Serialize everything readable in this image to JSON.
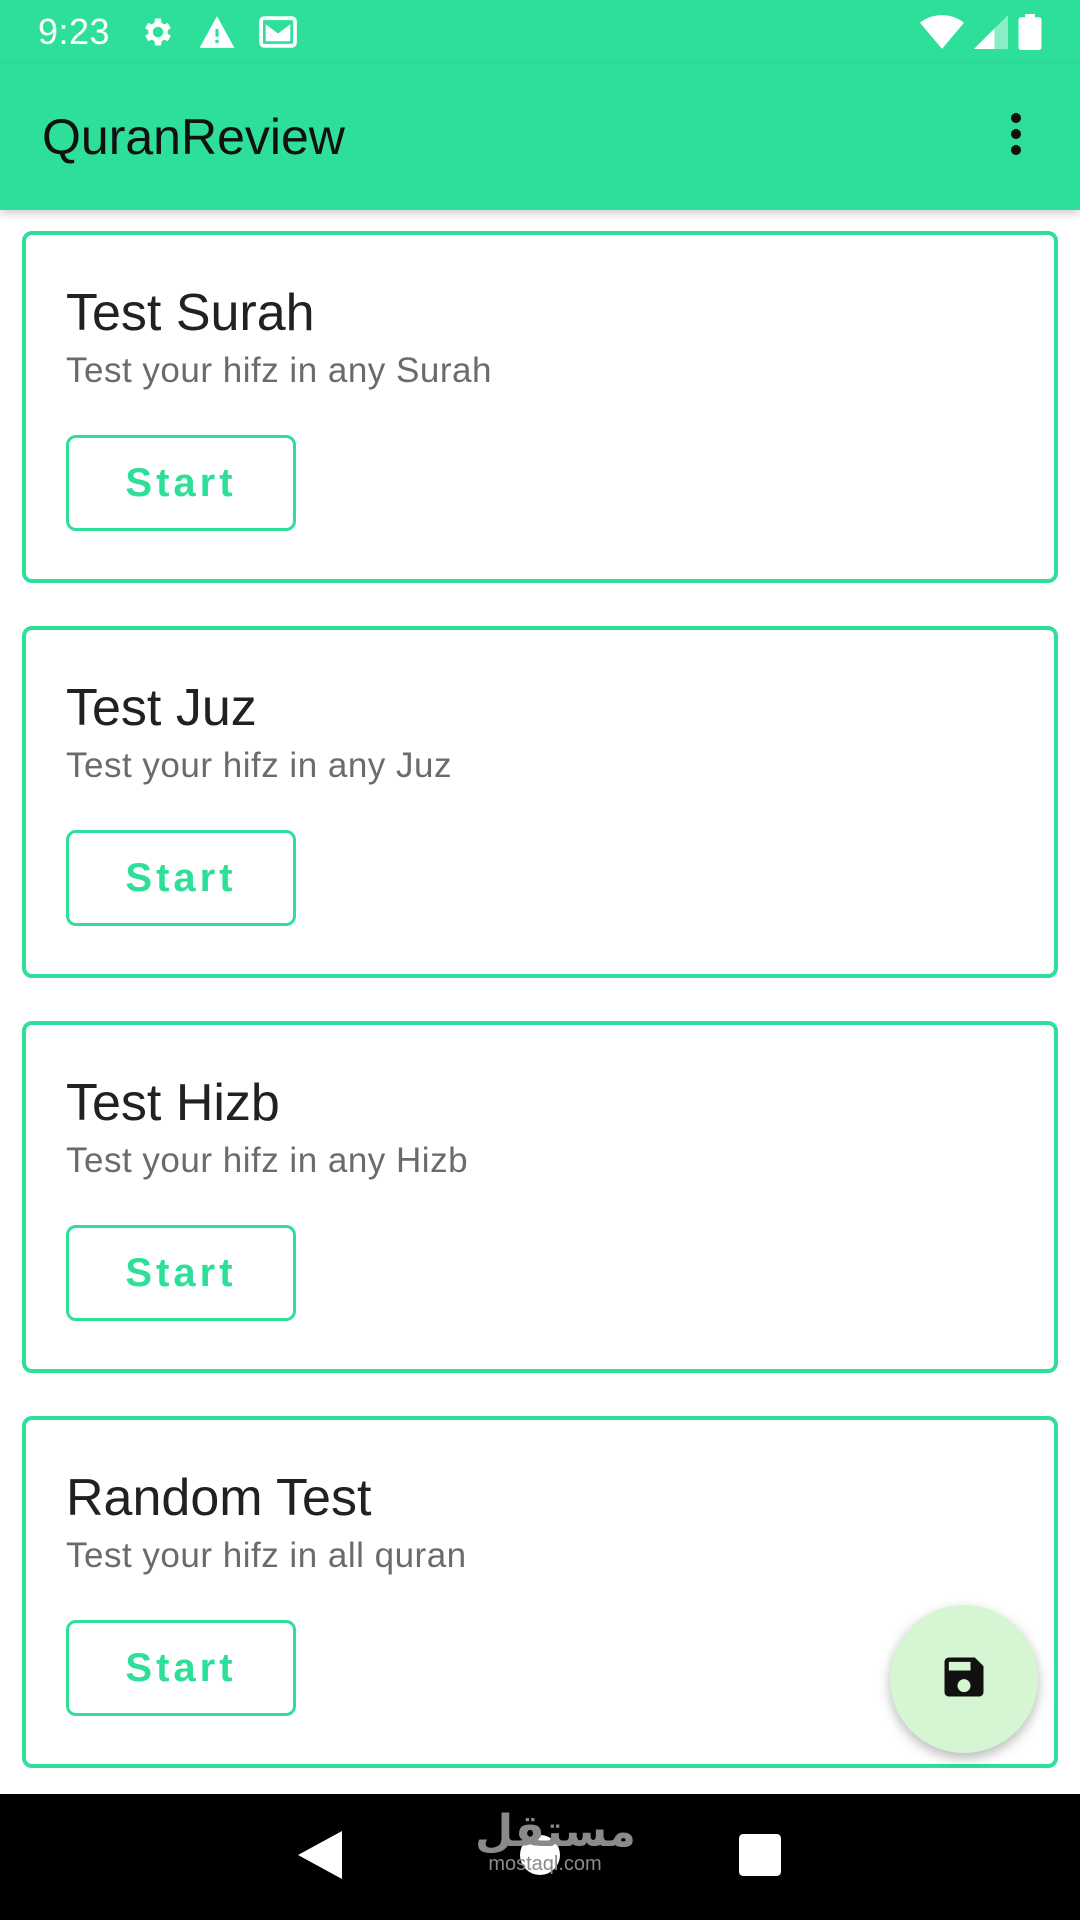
{
  "status_bar": {
    "time": "9:23",
    "left_icons": [
      "gear-icon",
      "warning-icon",
      "mail-icon"
    ],
    "right_icons": [
      "wifi-icon",
      "cell-signal-icon",
      "battery-icon"
    ]
  },
  "app_bar": {
    "title": "QuranReview",
    "menu_icon": "more-vert-icon"
  },
  "cards": [
    {
      "title": "Test Surah",
      "subtitle": "Test your hifz in any Surah",
      "button": "Start"
    },
    {
      "title": "Test Juz",
      "subtitle": "Test your hifz in any Juz",
      "button": "Start"
    },
    {
      "title": "Test Hizb",
      "subtitle": "Test your hifz in any Hizb",
      "button": "Start"
    },
    {
      "title": "Random Test",
      "subtitle": "Test your hifz in all quran",
      "button": "Start"
    }
  ],
  "fab": {
    "icon": "save-icon"
  },
  "nav_bar": {
    "buttons": [
      "back-icon",
      "home-icon",
      "recents-icon"
    ]
  },
  "watermark": {
    "arabic": "مستقل",
    "latin": "mostaql.com"
  },
  "colors": {
    "accent": "#2DDF98",
    "fab_bg": "#D6F5D2",
    "title_text": "#212121",
    "subtitle_text": "#6b6b6b",
    "nav_bg": "#000000"
  }
}
